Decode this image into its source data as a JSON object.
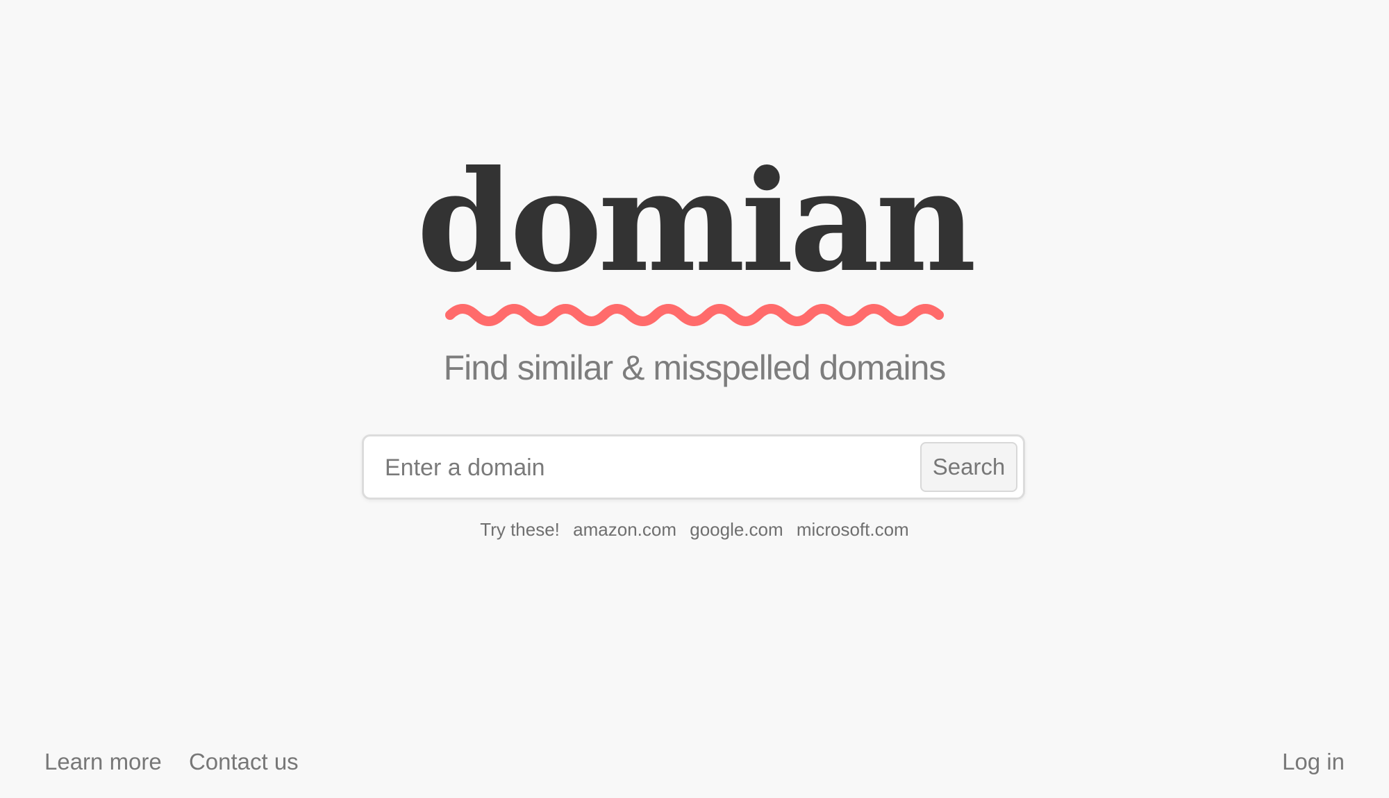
{
  "brand": {
    "logo_text": "domian",
    "accent_color": "#ff6b6b",
    "tagline": "Find similar & misspelled domains"
  },
  "search": {
    "placeholder": "Enter a domain",
    "value": "",
    "button_label": "Search"
  },
  "suggestions": {
    "label": "Try these!",
    "items": [
      "amazon.com",
      "google.com",
      "microsoft.com"
    ]
  },
  "footer": {
    "learn_more": "Learn more",
    "contact_us": "Contact us",
    "log_in": "Log in"
  },
  "icons": {
    "squiggle": "squiggle-underline-icon"
  }
}
